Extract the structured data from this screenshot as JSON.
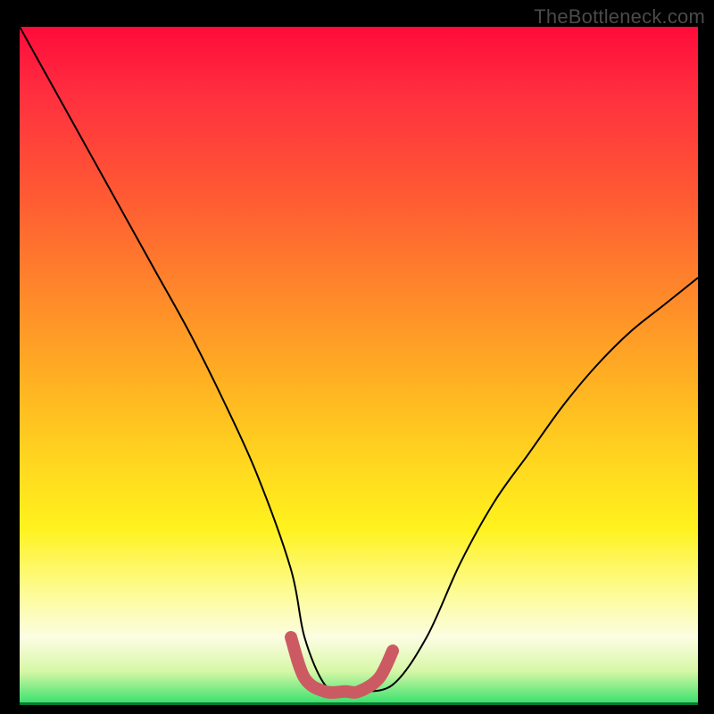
{
  "watermark": "TheBottleneck.com",
  "colors": {
    "frame": "#000000",
    "watermark_text": "#4a4a4a",
    "curve": "#000000",
    "trough_highlight": "#cc5a63",
    "gradient_stops": [
      "#ff0b3a",
      "#ff2f3f",
      "#ff5a33",
      "#ff8a2a",
      "#ffb322",
      "#ffd61f",
      "#fff21e",
      "#fdfc9c",
      "#fcfde2",
      "#d7f7a7",
      "#31e06a"
    ]
  },
  "chart_data": {
    "type": "line",
    "title": "",
    "xlabel": "",
    "ylabel": "",
    "xlim": [
      0,
      100
    ],
    "ylim": [
      0,
      100
    ],
    "grid": false,
    "legend": false,
    "series": [
      {
        "name": "bottleneck-curve",
        "x": [
          0,
          5,
          10,
          15,
          20,
          25,
          30,
          35,
          40,
          42,
          45,
          48,
          50,
          55,
          60,
          65,
          70,
          75,
          80,
          85,
          90,
          95,
          100
        ],
        "values": [
          100,
          91,
          82,
          73,
          64,
          55,
          45,
          34,
          20,
          10,
          3,
          2,
          2,
          3,
          10,
          21,
          30,
          37,
          44,
          50,
          55,
          59,
          63
        ]
      },
      {
        "name": "optimal-range-highlight",
        "x": [
          40,
          42,
          45,
          48,
          50,
          53,
          55
        ],
        "values": [
          10,
          4,
          2,
          2,
          2,
          4,
          8
        ]
      }
    ],
    "annotations": []
  }
}
